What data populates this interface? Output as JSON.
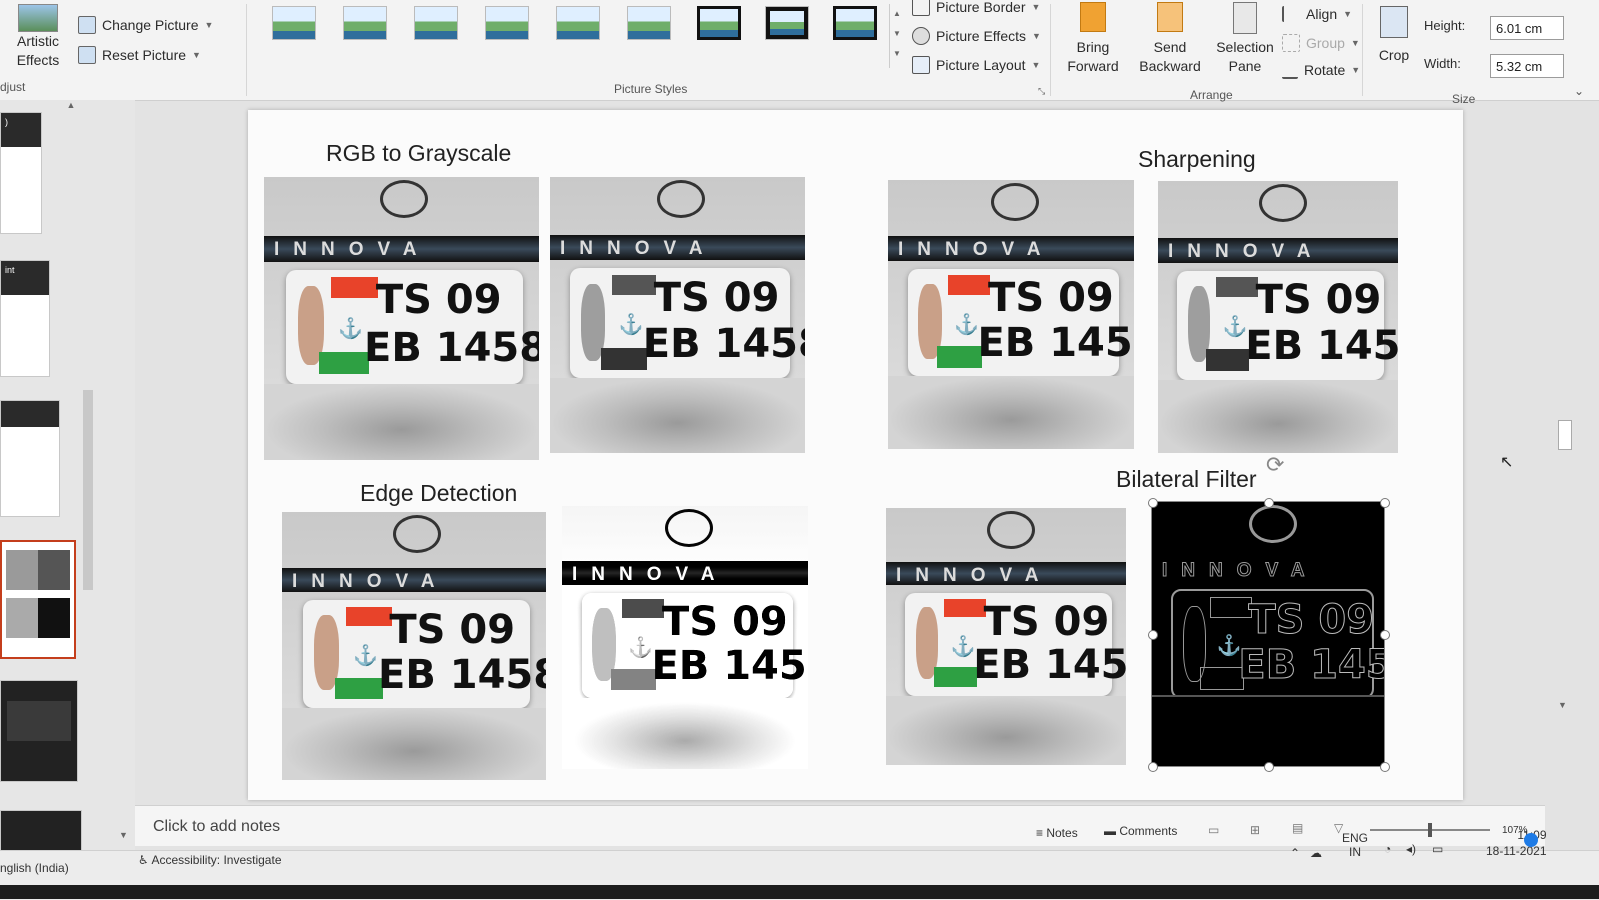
{
  "ribbon": {
    "artistic_effects": "Artistic\nEffects",
    "change_picture": "Change Picture",
    "reset_picture": "Reset Picture",
    "adjust_group": "djust",
    "picture_styles_group": "Picture Styles",
    "picture_border": "Picture Border",
    "picture_effects": "Picture Effects",
    "picture_layout": "Picture Layout",
    "bring_forward": "Bring\nForward",
    "send_backward": "Send\nBackward",
    "selection_pane": "Selection\nPane",
    "align": "Align",
    "group": "Group",
    "rotate": "Rotate",
    "arrange_group": "Arrange",
    "crop": "Crop",
    "height_label": "Height:",
    "height_value": "6.01 cm",
    "width_label": "Width:",
    "width_value": "5.32 cm",
    "size_group": "Size",
    "accent_color": "#f0a232"
  },
  "thumbnails": {
    "partial_labels": [
      ")",
      "int"
    ]
  },
  "slide": {
    "headings": {
      "rgb_to_grayscale": "RGB to Grayscale",
      "sharpening": "Sharpening",
      "edge_detection": "Edge Detection",
      "bilateral_filter": "Bilateral Filter"
    },
    "plate": {
      "brand": "INNOVA",
      "line1": "TS 09",
      "line2": "EB 1458"
    },
    "images": [
      {
        "name": "rgb-original",
        "style": "color"
      },
      {
        "name": "rgb-grayscale",
        "style": "gray"
      },
      {
        "name": "sharpen-original",
        "style": "color"
      },
      {
        "name": "sharpen-result",
        "style": "gray"
      },
      {
        "name": "edge-original",
        "style": "color"
      },
      {
        "name": "edge-result",
        "style": "bw"
      },
      {
        "name": "bilateral-original",
        "style": "color"
      },
      {
        "name": "bilateral-result",
        "style": "edges"
      }
    ]
  },
  "notes": {
    "placeholder": "Click to add notes"
  },
  "status": {
    "language": "nglish (India)",
    "accessibility": "Accessibility: Investigate",
    "notes_btn": "Notes",
    "comments_btn": "Comments",
    "zoom": "107%",
    "input_lang_top": "ENG",
    "input_lang_bottom": "IN",
    "time": "11:09",
    "date": "18-11-2021"
  }
}
